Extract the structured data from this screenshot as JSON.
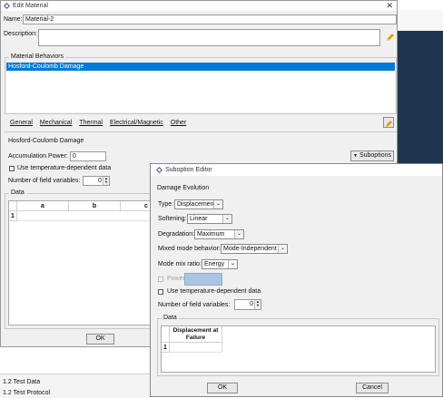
{
  "edit_material": {
    "title": "Edit Material",
    "name_label": "Name:",
    "name_value": "Material-2",
    "description_label": "Description:",
    "behaviors_group": "Material Behaviors",
    "behavior_selected": "Hosford-Coulomb Damage",
    "menus": [
      "General",
      "Mechanical",
      "Thermal",
      "Electrical/Magnetic",
      "Other"
    ],
    "section_title": "Hosford-Coulomb Damage",
    "accumulation_power_label": "Accumulation Power:",
    "accumulation_power_value": "0",
    "temp_dep_label": "Use temperature-dependent data",
    "field_vars_label": "Number of field variables:",
    "field_vars_value": "0",
    "suboptions_label": "Suboptions",
    "data_group": "Data",
    "columns": [
      "a",
      "b",
      "c"
    ],
    "row_index": "1",
    "ok_label": "OK"
  },
  "background_panel": {
    "rows": [
      "1.2  Test Data",
      "1.2 Test Protocol"
    ]
  },
  "suboption_editor": {
    "title": "Suboption Editor",
    "group_title": "Damage Evolution",
    "type_label": "Type:",
    "type_value": "Displacement",
    "softening_label": "Softening:",
    "softening_value": "Linear",
    "degradation_label": "Degradation:",
    "degradation_value": "Maximum",
    "mixed_mode_label": "Mixed mode behavior:",
    "mixed_mode_value": "Mode-Independent",
    "mode_mix_label": "Mode mix ratio:",
    "mode_mix_value": "Energy",
    "power_label": "Power:",
    "temp_dep_label": "Use temperature-dependent data",
    "field_vars_label": "Number of field variables:",
    "field_vars_value": "0",
    "data_group": "Data",
    "column_header": "Displacement at Failure",
    "row_index": "1",
    "ok_label": "OK",
    "cancel_label": "Cancel"
  },
  "colors": {
    "selection": "#0078d7",
    "dark_background": "#1e3650",
    "dialog_bg": "#f0f0f0",
    "pencil": "#e0a000"
  }
}
